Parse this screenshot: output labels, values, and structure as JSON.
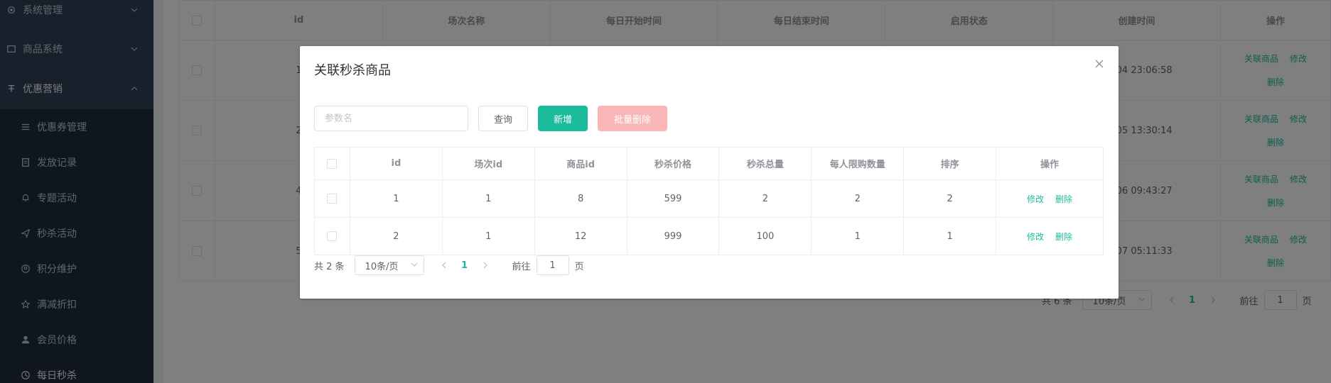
{
  "sidebar": {
    "items": [
      {
        "label": "系统管理",
        "icon": "gear-icon"
      },
      {
        "label": "商品系统",
        "icon": "product-icon"
      },
      {
        "label": "优惠营销",
        "icon": "marketing-icon"
      },
      {
        "label": "优惠券管理",
        "icon": "list-icon"
      },
      {
        "label": "发放记录",
        "icon": "record-icon"
      },
      {
        "label": "专题活动",
        "icon": "bell-icon"
      },
      {
        "label": "秒杀活动",
        "icon": "send-icon"
      },
      {
        "label": "积分维护",
        "icon": "points-icon"
      },
      {
        "label": "满减折扣",
        "icon": "star-icon"
      },
      {
        "label": "会员价格",
        "icon": "user-icon"
      },
      {
        "label": "每日秒杀",
        "icon": "clock-icon"
      }
    ]
  },
  "bg_table": {
    "headers": [
      "id",
      "场次名称",
      "每日开始时间",
      "每日结束时间",
      "启用状态",
      "创建时间",
      "操作"
    ],
    "rows": [
      {
        "id": "1",
        "created": "07-04 23:06:58"
      },
      {
        "id": "2",
        "created": "07-05 13:30:14"
      },
      {
        "id": "4",
        "created": "07-06 09:43:27"
      },
      {
        "id": "5",
        "created": "07-07 05:11:33"
      }
    ],
    "op_link_products": "关联商品",
    "op_link_edit": "修改",
    "op_link_delete": "删除"
  },
  "bg_pager": {
    "total": "共 6 条",
    "page_size": "10条/页",
    "current_page": "1",
    "goto_label": "前往",
    "goto_value": "1",
    "page_suffix": "页"
  },
  "dialog": {
    "title": "关联秒杀商品",
    "search_placeholder": "参数名",
    "query_label": "查询",
    "add_label": "新增",
    "batch_delete_label": "批量删除",
    "headers": [
      "id",
      "场次id",
      "商品id",
      "秒杀价格",
      "秒杀总量",
      "每人限购数量",
      "排序",
      "操作"
    ],
    "rows": [
      {
        "id": "1",
        "session_id": "1",
        "product_id": "8",
        "price": "599",
        "total": "2",
        "limit": "2",
        "sort": "2"
      },
      {
        "id": "2",
        "session_id": "1",
        "product_id": "12",
        "price": "999",
        "total": "100",
        "limit": "1",
        "sort": "1"
      }
    ],
    "edit_label": "修改",
    "delete_label": "删除",
    "pager": {
      "total": "共 2 条",
      "page_size": "10条/页",
      "current_page": "1",
      "goto_label": "前往",
      "goto_value": "1",
      "page_suffix": "页"
    }
  },
  "colors": {
    "sidebar_bg": "#304156",
    "accent": "#1abc9c",
    "danger_disabled": "#fab6b6"
  }
}
